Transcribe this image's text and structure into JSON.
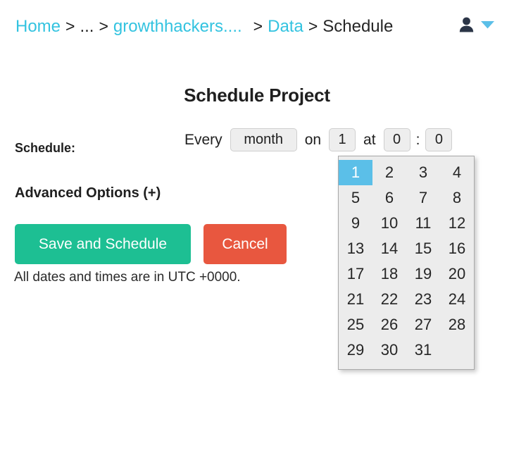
{
  "breadcrumb": {
    "home": "Home",
    "sep1": ">",
    "ellipsis": "...",
    "sep2": ">",
    "project": "growthhackers....",
    "sep3": ">",
    "data": "Data",
    "sep4": ">",
    "current": "Schedule"
  },
  "user_menu": {
    "avatar_icon": "person-icon",
    "caret_icon": "chevron-down-icon"
  },
  "page": {
    "title": "Schedule Project"
  },
  "form": {
    "schedule_label": "Schedule:",
    "every_label": "Every",
    "period_value": "month",
    "on_label": "on",
    "day_value": "1",
    "at_label": "at",
    "hour_value": "0",
    "colon": ":",
    "minute_value": "0",
    "advanced_options": "Advanced Options (+)",
    "utc_note": "All dates and times are in UTC +0000."
  },
  "buttons": {
    "save": "Save and Schedule",
    "cancel": "Cancel"
  },
  "day_picker": {
    "selected": "1",
    "days": [
      "1",
      "2",
      "3",
      "4",
      "5",
      "6",
      "7",
      "8",
      "9",
      "10",
      "11",
      "12",
      "13",
      "14",
      "15",
      "16",
      "17",
      "18",
      "19",
      "20",
      "21",
      "22",
      "23",
      "24",
      "25",
      "26",
      "27",
      "28",
      "29",
      "30",
      "31"
    ]
  },
  "colors": {
    "link": "#33c3e0",
    "save_green": "#1dbf93",
    "cancel_red": "#e8573f",
    "highlight_blue": "#5bbfe8",
    "field_bg": "#eeeeee",
    "panel_bg": "#ececec"
  }
}
